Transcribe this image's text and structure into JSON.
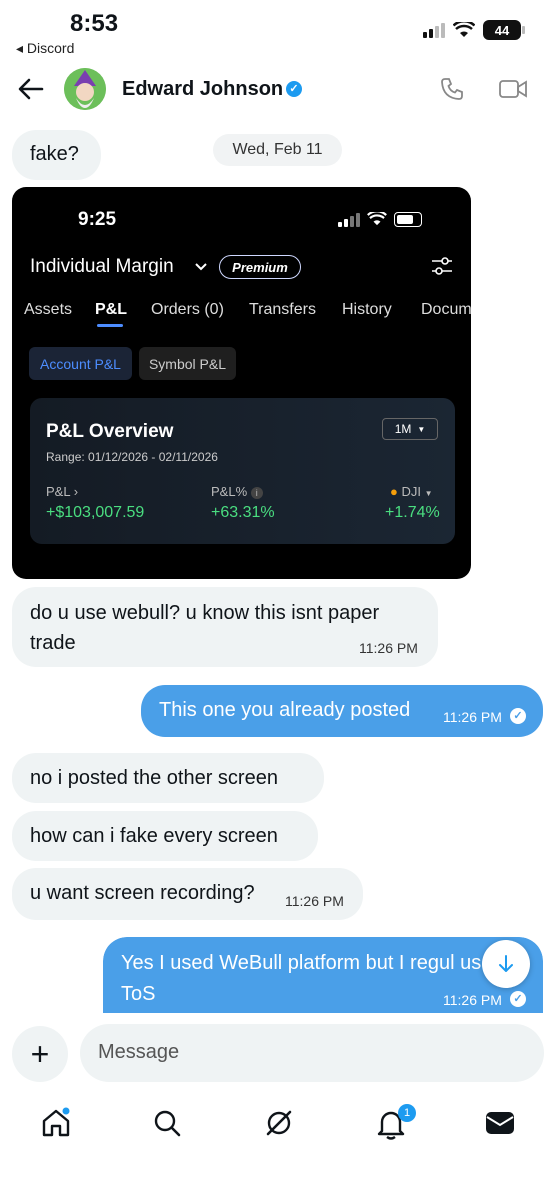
{
  "status": {
    "time": "8:53",
    "back_app": "◂ Discord",
    "battery": "44"
  },
  "header": {
    "name": "Edward Johnson"
  },
  "date_pill": "Wed, Feb 11",
  "messages": {
    "m1": "fake?",
    "m2": "do u use webull? u know this isnt paper trade",
    "m2_time": "11:26 PM",
    "m3": "This one you already posted",
    "m3_time": "11:26 PM",
    "m4": "no i posted the other screen",
    "m5": "how can i fake every screen",
    "m6": "u want screen recording?",
    "m6_time": "11:26 PM",
    "m7": "Yes I used WeBull platform but I regul use ToS",
    "m7_time": "11:26 PM"
  },
  "screenshot": {
    "time": "9:25",
    "account": "Individual Margin",
    "premium": "Premium",
    "tabs": [
      "Assets",
      "P&L",
      "Orders (0)",
      "Transfers",
      "History",
      "Docum"
    ],
    "filters": [
      "Account P&L",
      "Symbol P&L"
    ],
    "card_title": "P&L Overview",
    "range": "Range: 01/12/2026 - 02/11/2026",
    "period": "1M",
    "pl_label": "P&L",
    "pl_value": "+$103,007.59",
    "plpct_label": "P&L%",
    "plpct_value": "+63.31%",
    "index_label": "DJI",
    "index_value": "+1.74%"
  },
  "composer": {
    "placeholder": "Message"
  },
  "nav": {
    "notif_count": "1"
  },
  "colors": {
    "accent": "#1d9bf0",
    "bubble_right": "#4a9fe8",
    "gain": "#4ade80"
  }
}
